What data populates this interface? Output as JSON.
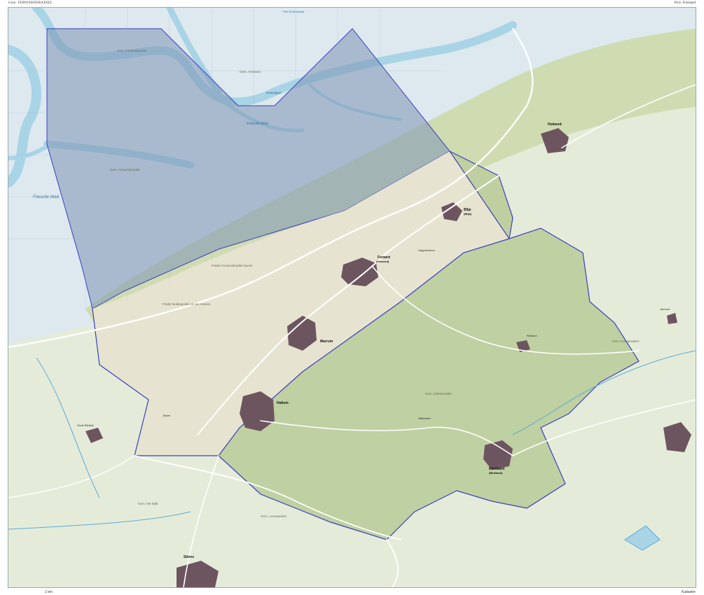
{
  "header": {
    "title_left": "Gem. FERWERDERADIEL",
    "title_right": "Prov. Friesland"
  },
  "footer": {
    "scale_note": "1 km",
    "credit": "Kadaster"
  },
  "colors": {
    "sea": "#dde9ef",
    "sea_channel": "#a8d4e6",
    "municipality_sea_fill": "#7e93b4",
    "boundary": "#3a3fbf",
    "saltmarsh": "#cfdcb2",
    "polder_land": "#e6e4d0",
    "municipality_land": "#b8cb98",
    "outside_land": "#e4ecd9",
    "urban": "#6d5560",
    "road": "#ffffff",
    "water_line": "#5ea9d6"
  },
  "map": {
    "water_labels": {
      "friesche_wad_left": "Friesche Wad",
      "friesche_wad_center": "Friesche Wad",
      "piet_scheveplaat": "Piet Scheveplaat",
      "dantziggat": "Dantziggat",
      "gem_ameland": "Gem. Ameland",
      "gem_ferwerderadiel_a": "Gem. Ferwerderadiel",
      "gem_ferwerderadiel_b": "Gem. Ferwerderadiel"
    },
    "places": {
      "ferwert": "Ferwert",
      "ferwert_sub": "(Ferwerd)",
      "marrum": "Marrum",
      "hallum": "Hallum",
      "blije": "Blije",
      "blije_sub": "(Blija)",
      "burdaard": "Burdaard",
      "burdaard_sub": "(Birdaard)",
      "hegebeintum": "Hegebeintum",
      "jislum": "Jislum",
      "reitsum": "Reitsum",
      "jannum": "Jannum",
      "wanswert": "Wânswert",
      "holwerd": "Holwerd",
      "stiens": "Stiens",
      "oude_bildtzijl": "Oude Bildtzijl"
    },
    "area_labels": {
      "gem_dongeradeel": "Gem. Dongeradeel",
      "gem_dantumadiel": "Gem. Dantumadiel",
      "gem_leeuwarden": "Gem. Leeuwarden",
      "gem_het_bildt": "Gem. het Bildt",
      "polder_bokkepolder": "Polder Bokkepolder en de Hoeken",
      "polder_ferwerderpolder": "Polder Ferwerderadiel Noord"
    }
  }
}
